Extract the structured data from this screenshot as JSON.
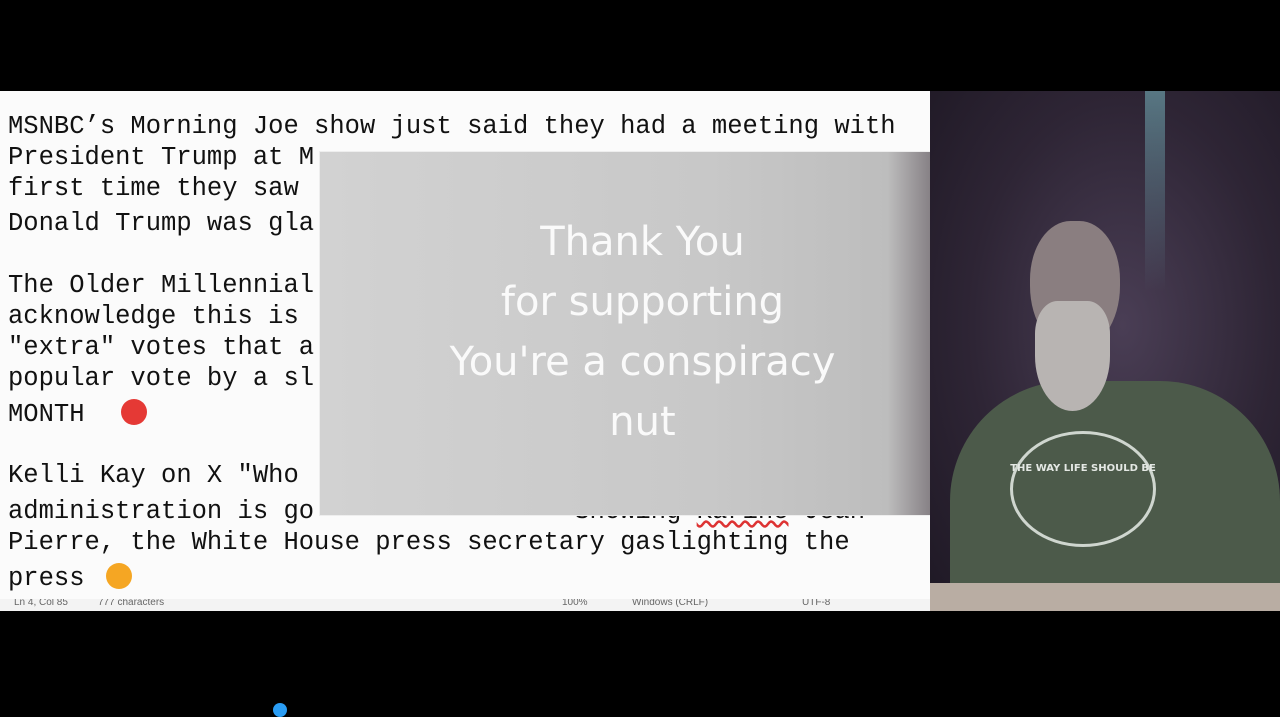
{
  "editor": {
    "lines": [
      "MSNBC’s Morning Joe show just said they had a meeting with",
      "President Trump at M",
      "first time they saw",
      "Donald Trump was gla",
      "The Older Millennial",
      "acknowledge this is",
      "\"extra\" votes that a",
      "popular vote by a sl",
      "MONTH",
      "Kelli Kay on X \"Who",
      "administration is go",
      "Pierre, the White House press secretary gaslighting the",
      "press"
    ],
    "line10_tail_a": "Showing",
    "line10_tail_b": "Karine",
    "line10_tail_c": "Jean",
    "emojis": [
      "angry-face-icon",
      "party-face-icon",
      "dizzy-face-icon"
    ],
    "status": {
      "position": "Ln 4, Col 85",
      "characters": "777 characters",
      "zoom": "100%",
      "line_ending": "Windows (CRLF)",
      "encoding": "UTF-8"
    }
  },
  "overlay": {
    "lines": [
      "Thank You",
      "for supporting",
      "You're a conspiracy",
      "nut"
    ]
  },
  "webcam": {
    "shirt_text": "THE WAY LIFE SHOULD BE"
  }
}
